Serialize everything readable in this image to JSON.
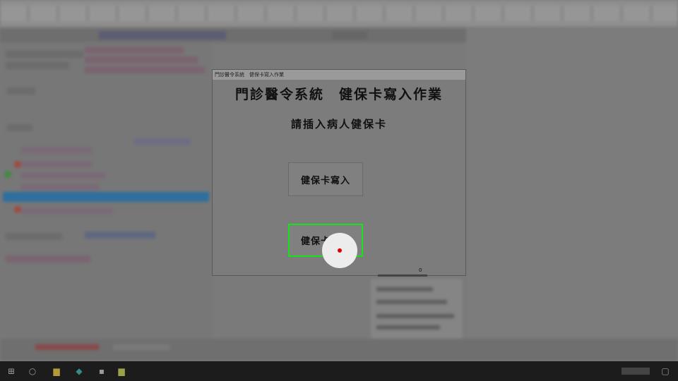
{
  "dialog": {
    "window_title": "門診醫令系統　健保卡寫入作業",
    "heading": "門診醫令系統　健保卡寫入作業",
    "instruction": "請插入病人健保卡",
    "write_button_label": "健保卡寫入",
    "error_button_label": "健保卡異常",
    "counter": "0"
  },
  "colors": {
    "highlight_border": "#19e019",
    "cursor_dot": "#e00000"
  }
}
